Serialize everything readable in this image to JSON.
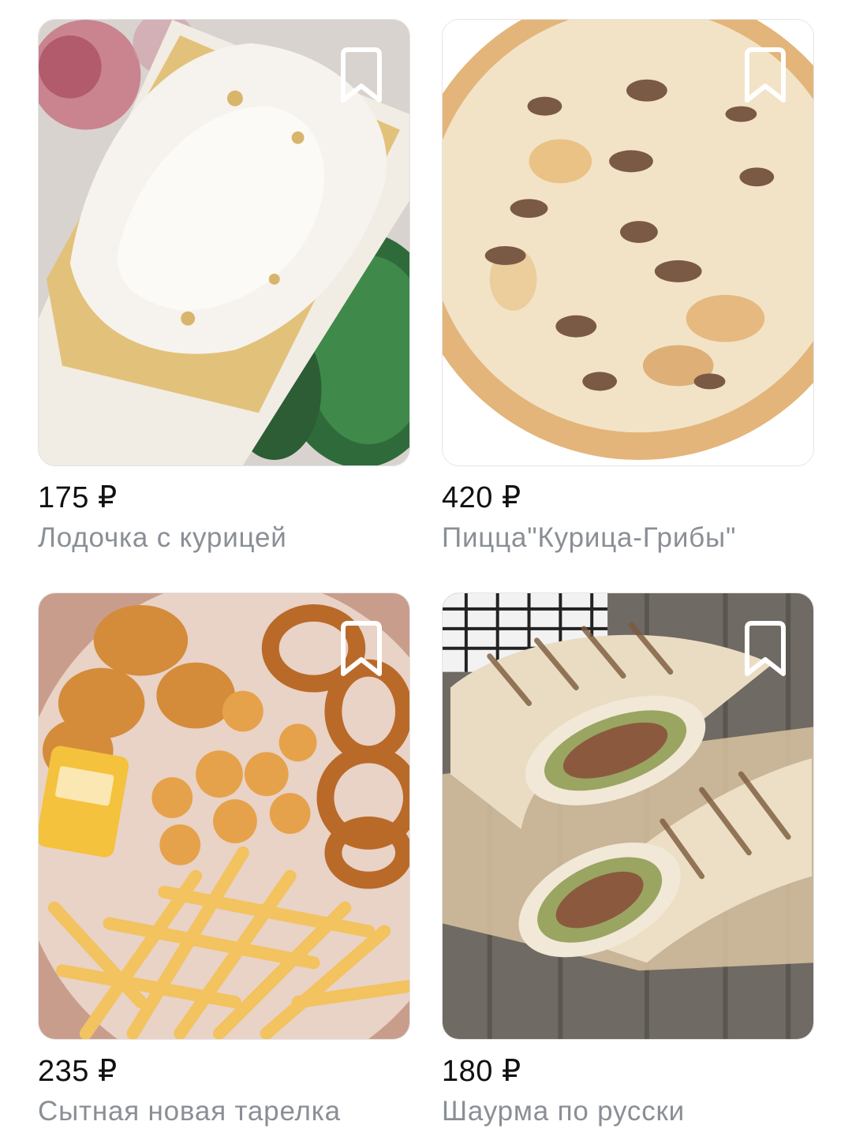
{
  "products": [
    {
      "price": "175 ₽",
      "name": "Лодочка с курицей",
      "image": "chicken-boat-photo",
      "bookmark_icon": "bookmark-icon"
    },
    {
      "price": "420 ₽",
      "name": "Пицца\"Курица-Грибы\"",
      "image": "chicken-mushroom-pizza-photo",
      "bookmark_icon": "bookmark-icon"
    },
    {
      "price": "235 ₽",
      "name": "Сытная новая тарелка",
      "image": "snack-plate-photo",
      "bookmark_icon": "bookmark-icon"
    },
    {
      "price": "180 ₽",
      "name": "Шаурма по русски",
      "image": "shawarma-photo",
      "bookmark_icon": "bookmark-icon"
    }
  ],
  "colors": {
    "price_text": "#111111",
    "name_text": "#8a8f96",
    "bookmark_stroke": "#ffffff"
  }
}
